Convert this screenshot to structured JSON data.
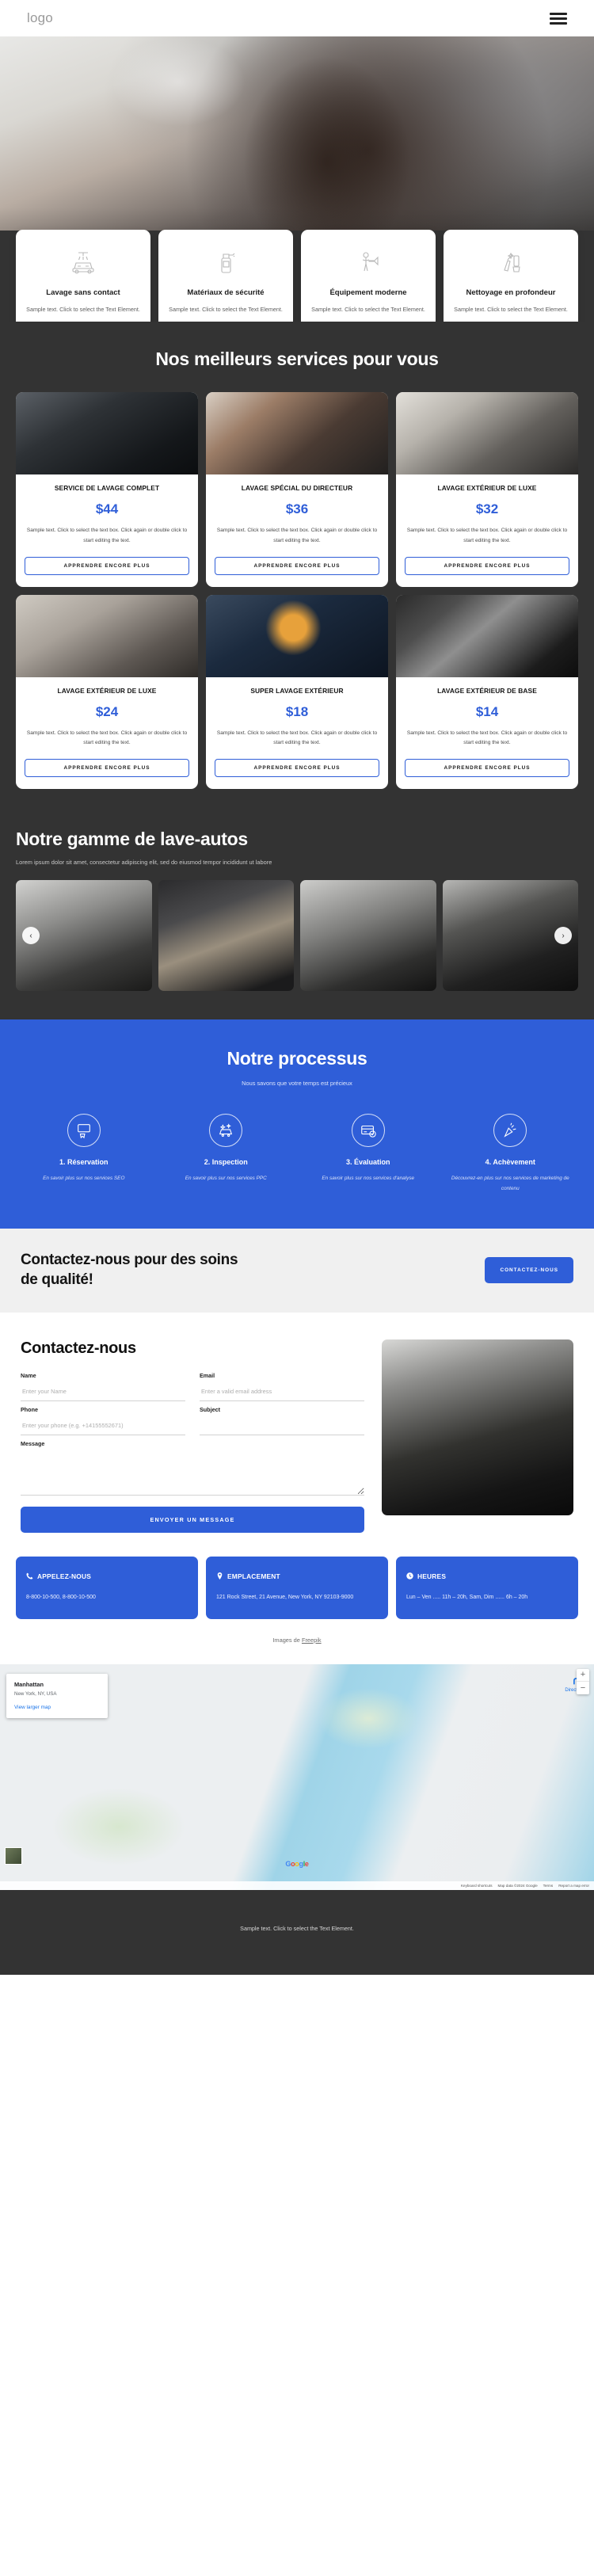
{
  "header": {
    "logo": "logo",
    "menu_icon": "hamburger-icon"
  },
  "features": [
    {
      "icon": "car-wash-shower-icon",
      "title": "Lavage sans contact",
      "text": "Sample text. Click to select the Text Element."
    },
    {
      "icon": "spray-bottle-icon",
      "title": "Matériaux de sécurité",
      "text": "Sample text. Click to select the Text Element."
    },
    {
      "icon": "pressure-washer-icon",
      "title": "Équipement moderne",
      "text": "Sample text. Click to select the Text Element."
    },
    {
      "icon": "deep-clean-brush-icon",
      "title": "Nettoyage en profondeur",
      "text": "Sample text. Click to select the Text Element."
    }
  ],
  "services": {
    "title": "Nos meilleurs services pour vous",
    "button_label": "APPRENDRE ENCORE PLUS",
    "items": [
      {
        "name": "SERVICE DE LAVAGE COMPLET",
        "price": "$44",
        "text": "Sample text. Click to select the text box. Click again or double click to start editing the text."
      },
      {
        "name": "LAVAGE SPÉCIAL DU DIRECTEUR",
        "price": "$36",
        "text": "Sample text. Click to select the text box. Click again or double click to start editing the text."
      },
      {
        "name": "LAVAGE EXTÉRIEUR DE LUXE",
        "price": "$32",
        "text": "Sample text. Click to select the text box. Click again or double click to start editing the text."
      },
      {
        "name": "LAVAGE EXTÉRIEUR DE LUXE",
        "price": "$24",
        "text": "Sample text. Click to select the text box. Click again or double click to start editing the text."
      },
      {
        "name": "SUPER LAVAGE EXTÉRIEUR",
        "price": "$18",
        "text": "Sample text. Click to select the text box. Click again or double click to start editing the text."
      },
      {
        "name": "LAVAGE EXTÉRIEUR DE BASE",
        "price": "$14",
        "text": "Sample text. Click to select the text box. Click again or double click to start editing the text."
      }
    ]
  },
  "gallery": {
    "title": "Notre gamme de lave-autos",
    "subtitle": "Lorem ipsum dolor sit amet, consectetur adipiscing elit, sed do eiusmod tempor incididunt ut labore",
    "prev_icon": "chevron-left-icon",
    "next_icon": "chevron-right-icon"
  },
  "process": {
    "title": "Notre processus",
    "subtitle": "Nous savons que votre temps est précieux",
    "steps": [
      {
        "icon": "book-cursor-icon",
        "label": "1. Réservation",
        "text": "En savoir plus sur nos services SEO"
      },
      {
        "icon": "sparkle-car-icon",
        "label": "2. Inspection",
        "text": "En savoir plus sur nos services PPC"
      },
      {
        "icon": "card-check-icon",
        "label": "3. Évaluation",
        "text": "En savoir plus sur nos services d'analyse"
      },
      {
        "icon": "confetti-icon",
        "label": "4. Achèvement",
        "text": "Découvrez-en plus sur nos services de marketing de contenu"
      }
    ]
  },
  "cta": {
    "title": "Contactez-nous pour des soins de qualité!",
    "button": "CONTACTEZ-NOUS"
  },
  "contact": {
    "title": "Contactez-nous",
    "name_label": "Name",
    "name_placeholder": "Enter your Name",
    "email_label": "Email",
    "email_placeholder": "Enter a valid email address",
    "phone_label": "Phone",
    "phone_placeholder": "Enter your phone (e.g. +14155552671)",
    "subject_label": "Subject",
    "subject_placeholder": "",
    "message_label": "Message",
    "message_placeholder": "",
    "submit": "ENVOYER UN MESSAGE"
  },
  "info_cards": [
    {
      "icon": "phone-icon",
      "title": "APPELEZ-NOUS",
      "text": "8-800-10-500, 8-800-10-500"
    },
    {
      "icon": "map-pin-icon",
      "title": "EMPLACEMENT",
      "text": "121 Rock Street, 21 Avenue, New York, NY 92103-9000"
    },
    {
      "icon": "clock-icon",
      "title": "HEURES",
      "text": "Lun – Ven ..... 11h – 20h, Sam, Dim ...... 6h – 20h"
    }
  ],
  "credit": {
    "prefix": "Images de ",
    "link": "Freepik"
  },
  "map": {
    "place_title": "Manhattan",
    "place_sub": "New York, NY, USA",
    "view_larger": "View larger map",
    "directions": "Directions",
    "directions_icon": "directions-arrow-icon",
    "zoom_in": "+",
    "zoom_out": "−",
    "keyboard_shortcuts": "Keyboard shortcuts",
    "map_data": "Map data ©2024 Google",
    "terms": "Terms",
    "report": "Report a map error",
    "brand": [
      "G",
      "o",
      "o",
      "g",
      "l",
      "e"
    ]
  },
  "footer": {
    "text": "Sample text. Click to select the Text Element."
  },
  "colors": {
    "accent": "#2f5ed8",
    "dark": "#333333",
    "light": "#f0f0f0"
  }
}
